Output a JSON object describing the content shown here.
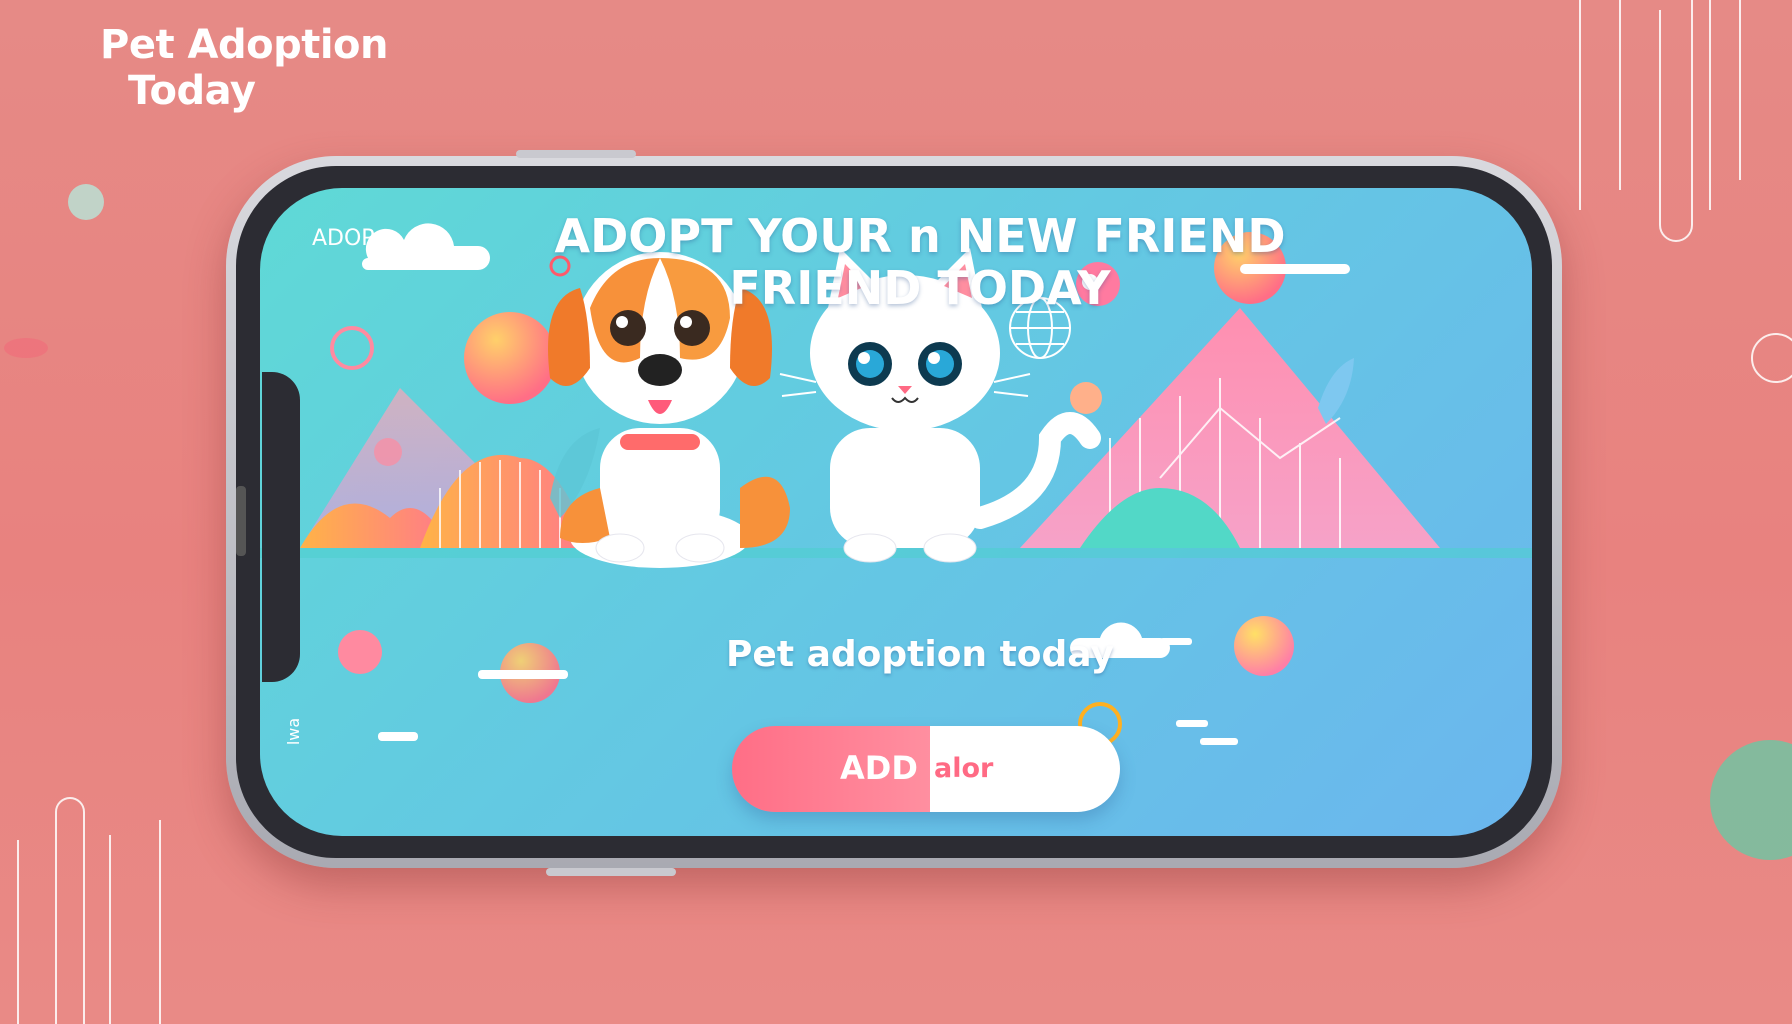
{
  "brand": {
    "line1": "Pet Adoption",
    "line2": "Today"
  },
  "screen": {
    "corner_label": "ADOP",
    "headline_line1": "ADOPT YOUR n NEW FRIEND",
    "headline_line2": "FRIEND TODAY",
    "subtitle": "Pet adoption today",
    "bottom_left_label": "lwa",
    "cta": {
      "left_label": "ADD",
      "right_label": "alor"
    }
  },
  "colors": {
    "background": "#e8827f",
    "screen_start": "#5fd9d6",
    "screen_end": "#6bb6ee",
    "cta_pink": "#ff6e86",
    "dog_orange": "#f7913a",
    "cat_white": "#ffffff"
  },
  "icons": [
    "dog-illustration",
    "cat-illustration",
    "cloud-icon",
    "globe-icon",
    "leaf-icon",
    "orb-icon",
    "ring-icon"
  ]
}
